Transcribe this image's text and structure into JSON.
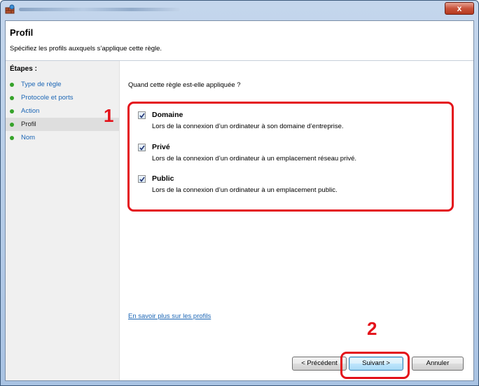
{
  "window": {
    "close_label": "x"
  },
  "header": {
    "title": "Profil",
    "description": "Spécifiez les profils auxquels s’applique cette règle."
  },
  "sidebar": {
    "title": "Étapes :",
    "items": [
      {
        "label": "Type de règle",
        "current": false
      },
      {
        "label": "Protocole et ports",
        "current": false
      },
      {
        "label": "Action",
        "current": false
      },
      {
        "label": "Profil",
        "current": true
      },
      {
        "label": "Nom",
        "current": false
      }
    ]
  },
  "main": {
    "question": "Quand cette règle est-elle appliquée ?",
    "options": [
      {
        "title": "Domaine",
        "description": "Lors de la connexion d’un ordinateur à son domaine d’entreprise.",
        "checked": true
      },
      {
        "title": "Privé",
        "description": "Lors de la connexion d’un ordinateur à un emplacement réseau privé.",
        "checked": true
      },
      {
        "title": "Public",
        "description": "Lors de la connexion d’un ordinateur à un emplacement public.",
        "checked": true
      }
    ],
    "learn_more_link": "En savoir plus sur les profils"
  },
  "buttons": {
    "previous": "< Précédent",
    "next": "Suivant >",
    "cancel": "Annuler"
  },
  "annotations": {
    "marker_1": "1",
    "marker_2": "2",
    "highlight_color": "#e4121a"
  },
  "colors": {
    "link": "#1c66b5",
    "step_bullet": "#36a32b"
  }
}
